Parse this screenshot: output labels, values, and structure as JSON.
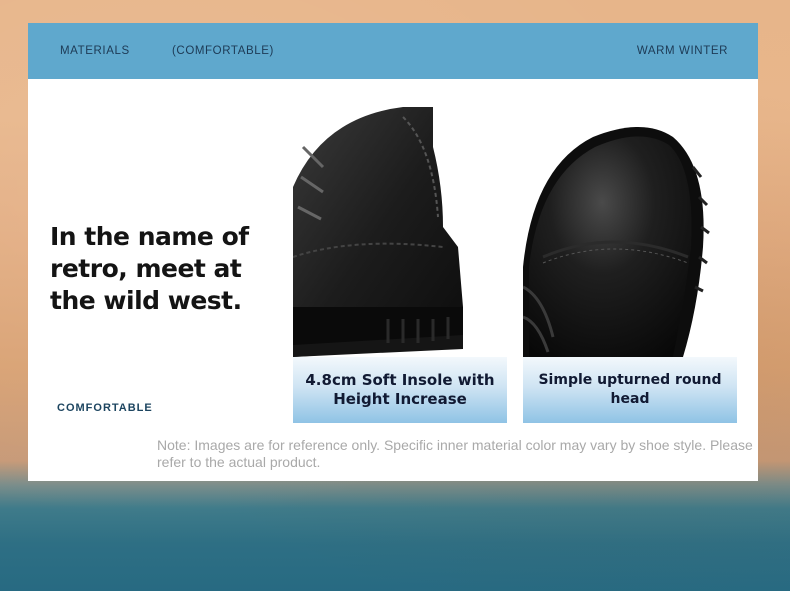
{
  "header": {
    "left_1": "MATERIALS",
    "left_2": "(COMFORTABLE)",
    "right": "WARM WINTER"
  },
  "hero": {
    "headline": "In the name of retro, meet at the wild west.",
    "tag": "COMFORTABLE"
  },
  "features": [
    {
      "caption": "4.8cm Soft Insole with Height Increase",
      "image_icon": "boot-heel-photo"
    },
    {
      "caption": "Simple upturned round head",
      "image_icon": "boot-toe-photo"
    }
  ],
  "note": "Note: Images are for reference only. Specific inner material color may vary by shoe style. Please refer to the actual product.",
  "colors": {
    "header_bar": "#5fa8cd",
    "card": "#ffffff",
    "caption_blue": "#8fc3e5"
  }
}
